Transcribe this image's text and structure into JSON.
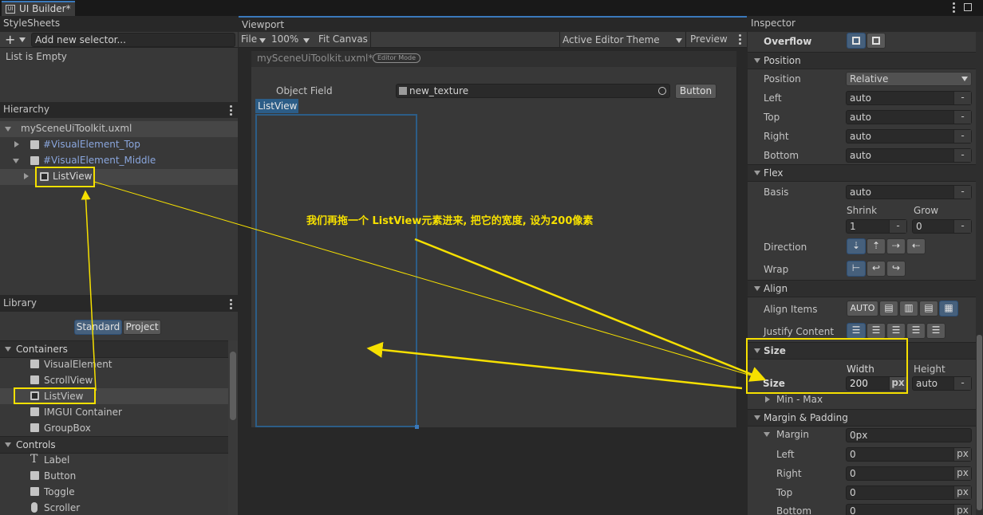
{
  "tab": {
    "title": "UI Builder*",
    "icon": "ui-builder-icon"
  },
  "stylesheets": {
    "title": "StyleSheets",
    "add_label": "+",
    "selector_placeholder": "Add new selector...",
    "empty_text": "List is Empty"
  },
  "hierarchy": {
    "title": "Hierarchy",
    "root": "mySceneUiToolkit.uxml",
    "items": [
      "#VisualElement_Top",
      "#VisualElement_Middle",
      "ListView"
    ]
  },
  "library": {
    "title": "Library",
    "tabs": [
      "Standard",
      "Project"
    ],
    "containers_header": "Containers",
    "containers": [
      "VisualElement",
      "ScrollView",
      "ListView",
      "IMGUI Container",
      "GroupBox"
    ],
    "controls_header": "Controls",
    "controls": [
      "Label",
      "Button",
      "Toggle",
      "Scroller"
    ]
  },
  "viewport": {
    "title": "Viewport",
    "file_menu": "File",
    "zoom": "100%",
    "fit_canvas": "Fit Canvas",
    "theme": "Active Editor Theme",
    "preview": "Preview",
    "doc_name": "mySceneUiToolkit.uxml*",
    "mode_badge": "Editor Mode",
    "object_field_label": "Object Field",
    "object_field_value": "new_texture",
    "button_label": "Button",
    "listview_tag": "ListView"
  },
  "annotation": {
    "text": "我们再拖一个 ListView元素进来, 把它的宽度, 设为200像素",
    "color": "#f6e000"
  },
  "inspector": {
    "title": "Inspector",
    "overflow_label": "Overflow",
    "position_header": "Position",
    "position_label": "Position",
    "position_value": "Relative",
    "left_label": "Left",
    "left_value": "auto",
    "top_label": "Top",
    "top_value": "auto",
    "right_label": "Right",
    "right_value": "auto",
    "bottom_label": "Bottom",
    "bottom_value": "auto",
    "flex_header": "Flex",
    "basis_label": "Basis",
    "basis_value": "auto",
    "shrink_label": "Shrink",
    "shrink_value": "1",
    "grow_label": "Grow",
    "grow_value": "0",
    "direction_label": "Direction",
    "wrap_label": "Wrap",
    "align_header": "Align",
    "align_items_label": "Align Items",
    "align_auto": "AUTO",
    "justify_label": "Justify Content",
    "size_header": "Size",
    "width_label": "Width",
    "height_label": "Height",
    "size_label": "Size",
    "width_value": "200",
    "width_unit": "px",
    "height_value": "auto",
    "minmax_label": "Min - Max",
    "margin_header": "Margin & Padding",
    "margin_label": "Margin",
    "margin_value": "0px",
    "m_left_label": "Left",
    "m_left_value": "0",
    "m_left_unit": "px",
    "m_right_label": "Right",
    "m_right_value": "0",
    "m_right_unit": "px",
    "m_top_label": "Top",
    "m_top_value": "0",
    "m_top_unit": "px",
    "m_bottom_label": "Bottom",
    "m_bottom_value": "0",
    "m_bottom_unit": "px",
    "minus": "-"
  },
  "colors": {
    "accent": "#46607c",
    "highlight": "#f6e000",
    "selection_blue": "#2c5d87"
  }
}
